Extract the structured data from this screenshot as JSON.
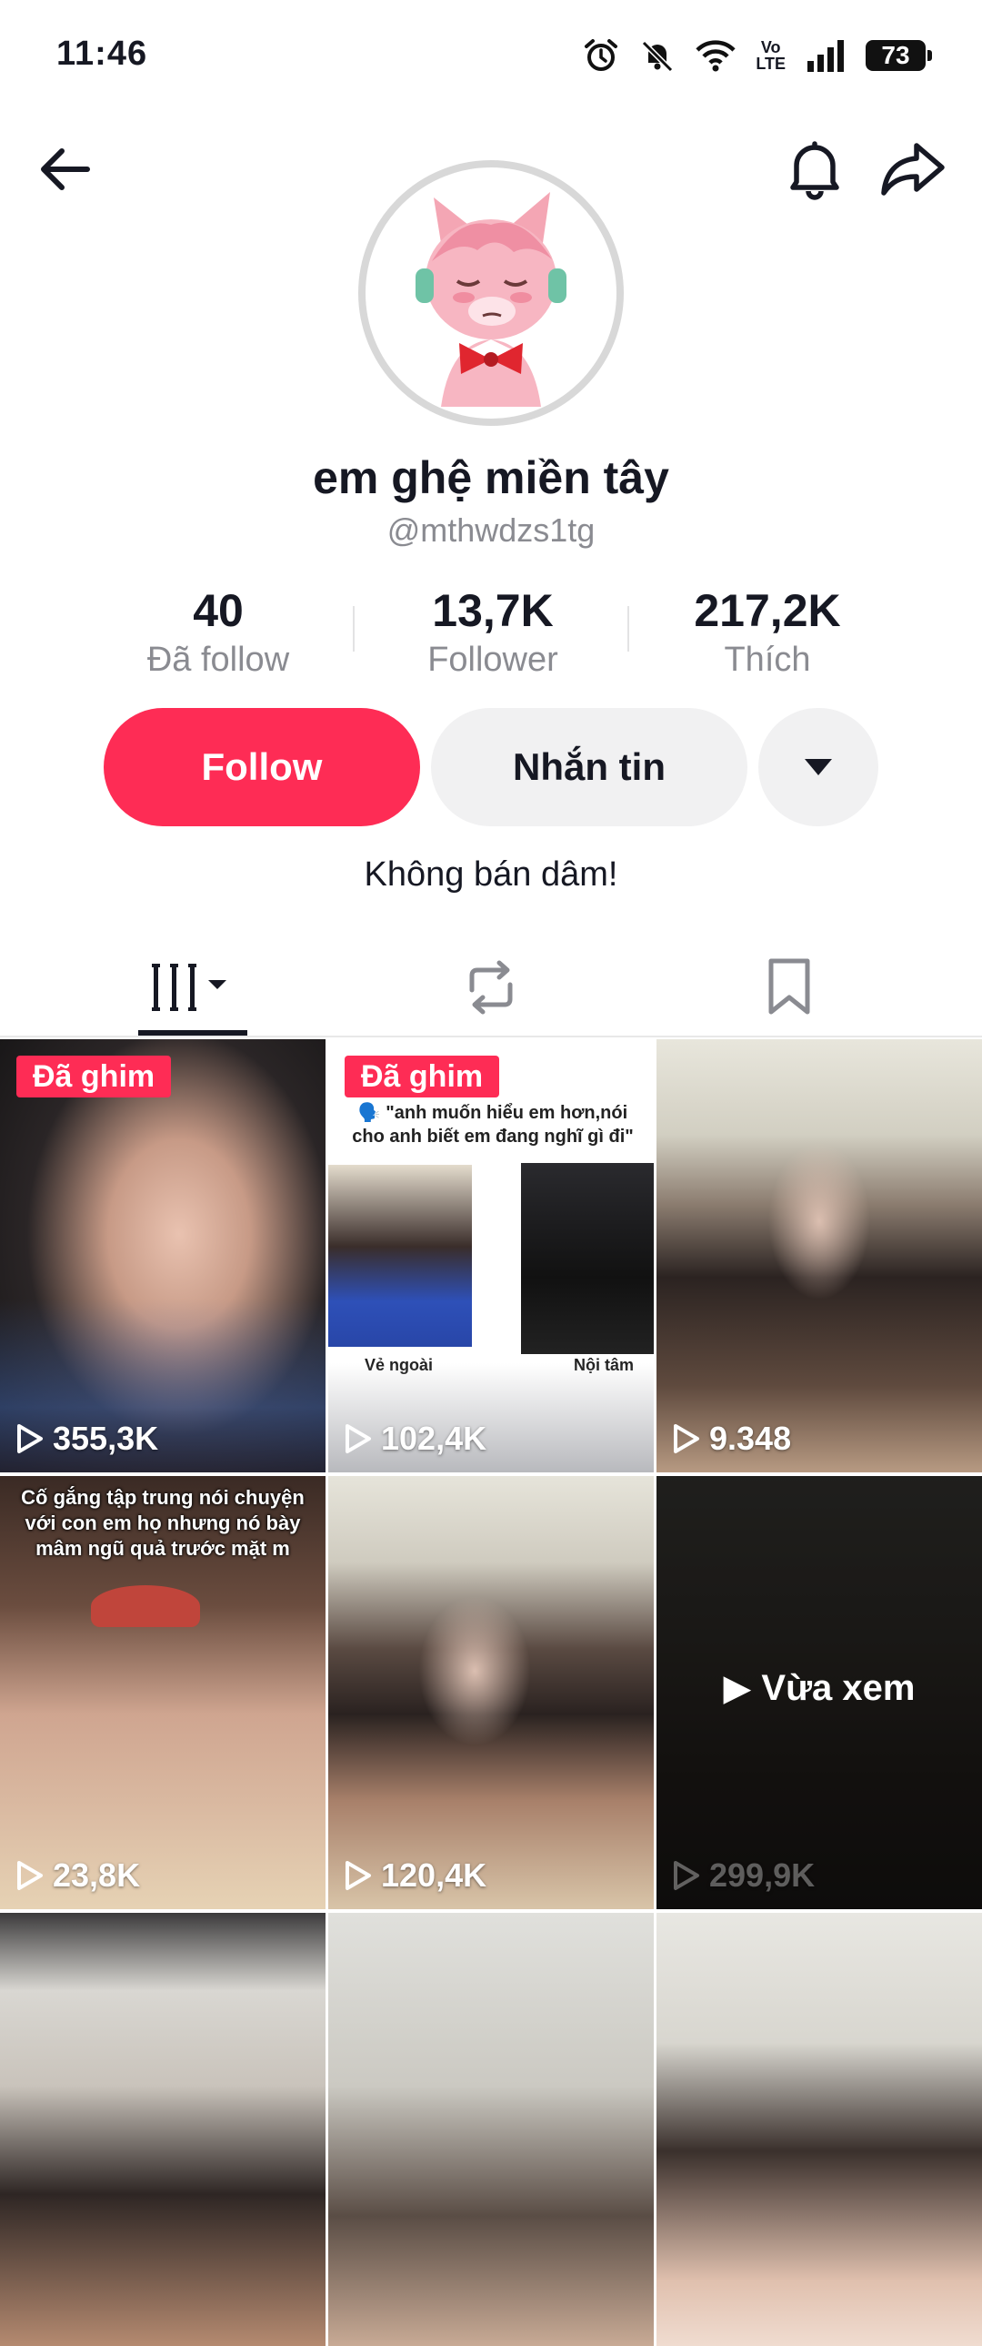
{
  "status_bar": {
    "time": "11:46",
    "network_label": "Vo\nLTE",
    "battery": "73"
  },
  "profile": {
    "display_name": "em ghệ miền tây",
    "username": "@mthwdzs1tg",
    "bio": "Không bán dâm!"
  },
  "stats": [
    {
      "value": "40",
      "label": "Đã follow"
    },
    {
      "value": "13,7K",
      "label": "Follower"
    },
    {
      "value": "217,2K",
      "label": "Thích"
    }
  ],
  "actions": {
    "follow_label": "Follow",
    "message_label": "Nhắn tin"
  },
  "tabs": [
    {
      "icon": "grid-videos-icon"
    },
    {
      "icon": "repost-icon"
    },
    {
      "icon": "bookmark-icon"
    }
  ],
  "videos": [
    {
      "views": "355,3K",
      "pinned": "Đã ghim"
    },
    {
      "views": "102,4K",
      "pinned": "Đã ghim",
      "quote": "🗣️ \"anh muốn hiểu em hơn,nói cho anh biết em đang nghĩ gì đi\"",
      "left_caption": "Vẻ ngoài",
      "right_caption": "Nội tâm"
    },
    {
      "views": "9.348"
    },
    {
      "views": "23,8K",
      "caption": "Cố gắng tập trung nói chuyện với con em họ nhưng nó bày mâm ngũ quả trước mặt m"
    },
    {
      "views": "120,4K"
    },
    {
      "views": "299,9K",
      "watched": "Vừa xem"
    },
    {
      "views": ""
    },
    {
      "views": ""
    },
    {
      "views": ""
    }
  ],
  "colors": {
    "accent": "#fe2c55",
    "secondary_button": "#f1f1f2",
    "muted_text": "#8a8b91"
  }
}
